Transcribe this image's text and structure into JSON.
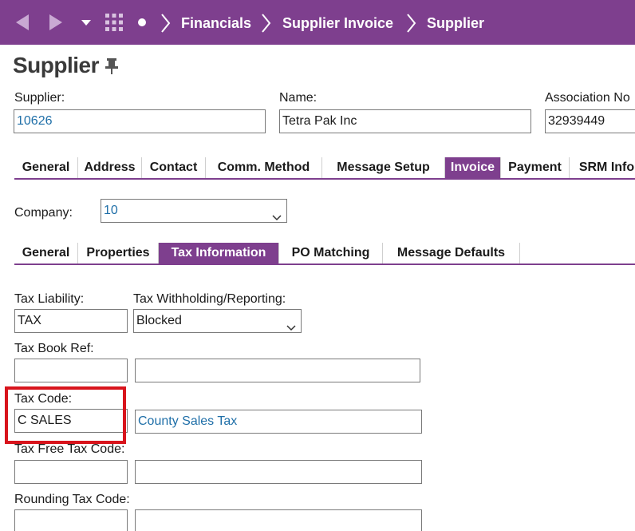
{
  "nav": {
    "back_icon": "back-arrow-icon",
    "forward_icon": "forward-arrow-icon",
    "menu_icon": "dropdown-caret-icon",
    "apps_icon": "app-grid-icon",
    "home_icon": "dot-icon",
    "breadcrumbs": [
      "Financials",
      "Supplier Invoice",
      "Supplier"
    ]
  },
  "page": {
    "title": "Supplier"
  },
  "header_fields": {
    "supplier_label": "Supplier:",
    "supplier_value": "10626",
    "name_label": "Name:",
    "name_value": "Tetra Pak Inc",
    "association_label": "Association No",
    "association_value": "32939449"
  },
  "main_tabs": [
    {
      "label": "General"
    },
    {
      "label": "Address"
    },
    {
      "label": "Contact"
    },
    {
      "label": "Comm. Method"
    },
    {
      "label": "Message Setup"
    },
    {
      "label": "Invoice",
      "active": true
    },
    {
      "label": "Payment"
    },
    {
      "label": "SRM Info"
    }
  ],
  "company": {
    "label": "Company:",
    "value": "10"
  },
  "sub_tabs": [
    {
      "label": "General"
    },
    {
      "label": "Properties"
    },
    {
      "label": "Tax Information",
      "active": true
    },
    {
      "label": "PO Matching"
    },
    {
      "label": "Message Defaults"
    }
  ],
  "tax": {
    "liability_label": "Tax Liability:",
    "liability_value": "TAX",
    "withholding_label": "Tax Withholding/Reporting:",
    "withholding_value": "Blocked",
    "book_ref_label": "Tax Book Ref:",
    "book_ref_value": "",
    "book_ref_desc": "",
    "code_label": "Tax Code:",
    "code_value": "C SALES",
    "code_desc": "County Sales Tax",
    "free_code_label": "Tax Free Tax Code:",
    "free_code_value": "",
    "free_code_desc": "",
    "rounding_label": "Rounding Tax Code:",
    "rounding_value": "",
    "rounding_desc": ""
  },
  "colors": {
    "brand": "#7e3f8e",
    "link": "#1f6fa8",
    "highlight": "#d8141c"
  }
}
